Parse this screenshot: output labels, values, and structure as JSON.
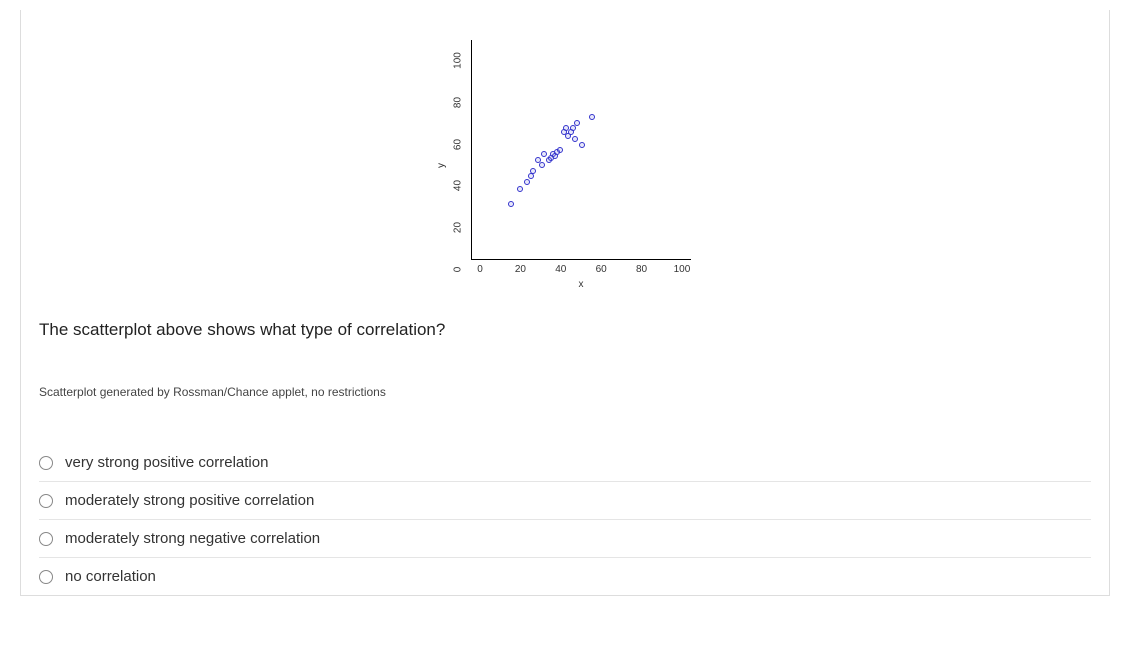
{
  "chart_data": {
    "type": "scatter",
    "xlabel": "x",
    "ylabel": "y",
    "xlim": [
      0,
      100
    ],
    "ylim": [
      0,
      100
    ],
    "x_ticks": [
      "0",
      "20",
      "40",
      "60",
      "80",
      "100"
    ],
    "y_ticks": [
      "100",
      "80",
      "60",
      "40",
      "20",
      "0"
    ],
    "points": [
      {
        "x": 18,
        "y": 25
      },
      {
        "x": 22,
        "y": 32
      },
      {
        "x": 25,
        "y": 35
      },
      {
        "x": 27,
        "y": 38
      },
      {
        "x": 28,
        "y": 40
      },
      {
        "x": 30,
        "y": 45
      },
      {
        "x": 32,
        "y": 43
      },
      {
        "x": 33,
        "y": 48
      },
      {
        "x": 35,
        "y": 45
      },
      {
        "x": 36,
        "y": 46
      },
      {
        "x": 37,
        "y": 48
      },
      {
        "x": 38,
        "y": 47
      },
      {
        "x": 39,
        "y": 49
      },
      {
        "x": 40,
        "y": 50
      },
      {
        "x": 42,
        "y": 58
      },
      {
        "x": 43,
        "y": 60
      },
      {
        "x": 44,
        "y": 56
      },
      {
        "x": 45,
        "y": 58
      },
      {
        "x": 46,
        "y": 60
      },
      {
        "x": 47,
        "y": 55
      },
      {
        "x": 48,
        "y": 62
      },
      {
        "x": 50,
        "y": 52
      },
      {
        "x": 55,
        "y": 65
      }
    ]
  },
  "question": {
    "text": "The scatterplot above shows what type of correlation?",
    "attribution": "Scatterplot generated by Rossman/Chance applet, no restrictions",
    "options": [
      "very strong positive correlation",
      "moderately strong positive correlation",
      "moderately strong negative correlation",
      "no correlation"
    ]
  }
}
